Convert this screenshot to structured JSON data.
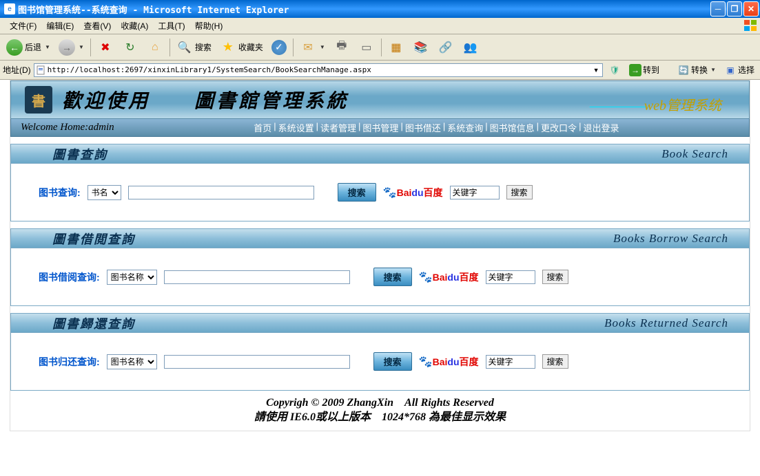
{
  "window": {
    "title": "图书馆管理系统--系统查询 - Microsoft Internet Explorer"
  },
  "menubar": {
    "file": "文件(F)",
    "edit": "编辑(E)",
    "view": "查看(V)",
    "favorites": "收藏(A)",
    "tools": "工具(T)",
    "help": "帮助(H)"
  },
  "toolbar": {
    "back": "后退",
    "search": "搜索",
    "favorites": "收藏夹"
  },
  "addressbar": {
    "label": "地址(D)",
    "url": "http://localhost:2697/xinxinLibrary1/SystemSearch/BookSearchManage.aspx",
    "go": "转到",
    "convert": "转换",
    "select": "选择"
  },
  "banner": {
    "title": "歡迎使用　　圖書館管理系統",
    "subtitle_dash": "—————",
    "subtitle_text": "web管理系统"
  },
  "navbar": {
    "welcome": "Welcome Home:admin",
    "links": [
      "首页",
      "系统设置",
      "读者管理",
      "图书管理",
      "图书借还",
      "系统查询",
      "图书馆信息",
      "更改口令",
      "退出登录"
    ]
  },
  "sections": [
    {
      "title_cn": "圖書查詢",
      "title_en": "Book  Search",
      "field_label": "图书查询:",
      "select_value": "书名",
      "search_btn": "搜索",
      "baidu_placeholder": "关键字",
      "baidu_btn": "搜索"
    },
    {
      "title_cn": "圖書借閲查詢",
      "title_en": "Books  Borrow  Search",
      "field_label": "图书借阅查询:",
      "select_value": "图书名称",
      "search_btn": "搜索",
      "baidu_placeholder": "关键字",
      "baidu_btn": "搜索"
    },
    {
      "title_cn": "圖書歸還查詢",
      "title_en": "Books  Returned  Search",
      "field_label": "图书归还查询:",
      "select_value": "图书名称",
      "search_btn": "搜索",
      "baidu_placeholder": "关键字",
      "baidu_btn": "搜索"
    }
  ],
  "baidu": {
    "bai": "Bai",
    "du": "du",
    "cn": "百度"
  },
  "footer": {
    "line1": "Copyrigh © 2009 ZhangXin　All Rights Reserved",
    "line2": "請使用 IE6.0或以上版本　1024*768 為最佳显示效果"
  }
}
